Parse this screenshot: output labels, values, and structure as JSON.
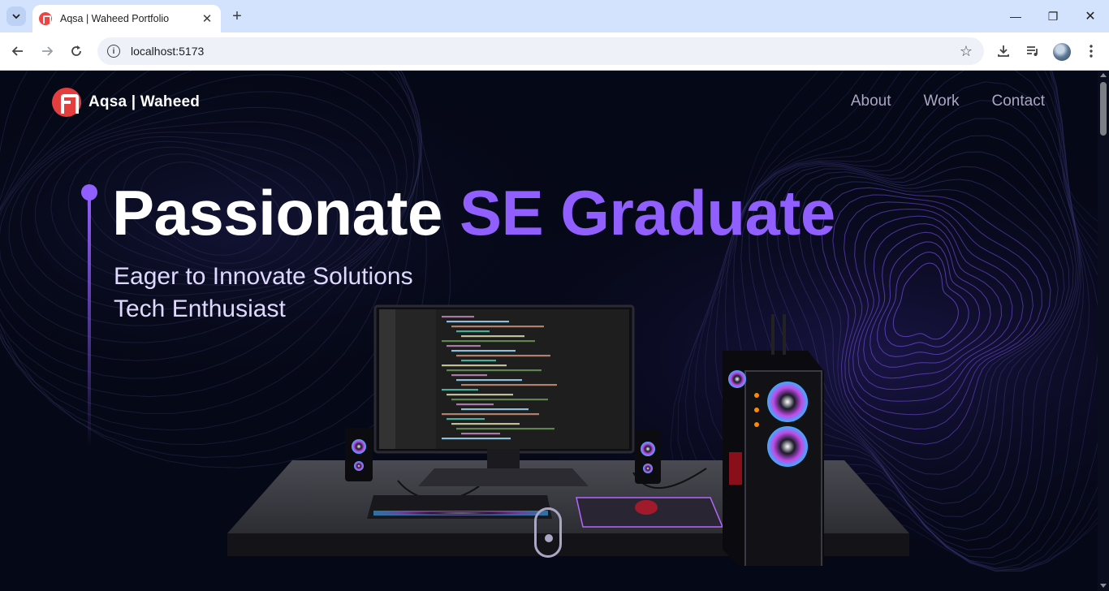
{
  "browser": {
    "tab_title": "Aqsa | Waheed Portfolio",
    "url": "localhost:5173",
    "tab_close_glyph": "✕",
    "new_tab_glyph": "+",
    "minimize_glyph": "—",
    "maximize_glyph": "❐",
    "close_glyph": "✕"
  },
  "nav": {
    "logo_text": "Aqsa | Waheed",
    "links": [
      "About",
      "Work",
      "Contact"
    ]
  },
  "hero": {
    "title_main": "Passionate ",
    "title_accent": "SE Graduate",
    "subtitle_line1": "Eager to Innovate Solutions",
    "subtitle_line2": "Tech Enthusiast"
  },
  "colors": {
    "accent": "#915eff",
    "background": "#050816",
    "logo": "#e53e3e",
    "nav_link": "#aaa6c3"
  }
}
